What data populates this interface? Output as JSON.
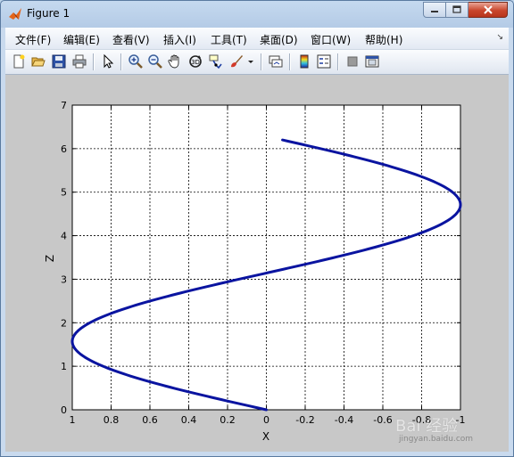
{
  "window": {
    "title": "Figure 1"
  },
  "menu": [
    {
      "label": "文件(F)",
      "name": "menu-file"
    },
    {
      "label": "编辑(E)",
      "name": "menu-edit"
    },
    {
      "label": "查看(V)",
      "name": "menu-view"
    },
    {
      "label": "插入(I)",
      "name": "menu-insert"
    },
    {
      "label": "工具(T)",
      "name": "menu-tools"
    },
    {
      "label": "桌面(D)",
      "name": "menu-desktop"
    },
    {
      "label": "窗口(W)",
      "name": "menu-window"
    },
    {
      "label": "帮助(H)",
      "name": "menu-help"
    }
  ],
  "toolbar": [
    "new-figure-icon",
    "open-file-icon",
    "save-icon",
    "print-icon",
    "edit-plot-pointer-icon",
    "zoom-in-icon",
    "zoom-out-icon",
    "pan-hand-icon",
    "rotate-3d-icon",
    "data-cursor-icon",
    "brush-icon",
    "link-plot-icon",
    "colorbar-icon",
    "legend-icon",
    "hide-plot-tools-icon",
    "show-plot-tools-icon"
  ],
  "colors": {
    "line": "#0a14a0",
    "figure_bg": "#c8c8c8",
    "axes_bg": "#ffffff"
  },
  "watermark": {
    "text": "Bai 经验",
    "url": "jingyan.baidu.com"
  },
  "chart_data": {
    "type": "line",
    "xlabel": "X",
    "ylabel": "Z",
    "xlim": [
      1,
      -1
    ],
    "ylim": [
      0,
      7
    ],
    "x_reversed": true,
    "grid": true,
    "grid_style": "dashed",
    "xticks": [
      1,
      0.8,
      0.6,
      0.4,
      0.2,
      0,
      -0.2,
      -0.4,
      -0.6,
      -0.8,
      -1
    ],
    "xtick_labels": [
      "1",
      "0.8",
      "0.6",
      "0.4",
      "0.2",
      "0",
      "-0.2",
      "-0.4",
      "-0.6",
      "-0.8",
      "-1"
    ],
    "yticks": [
      0,
      1,
      2,
      3,
      4,
      5,
      6,
      7
    ],
    "ytick_labels": [
      "0",
      "1",
      "2",
      "3",
      "4",
      "5",
      "6",
      "7"
    ],
    "series": [
      {
        "function": "x = sin(z)",
        "z_range": [
          0,
          6.2
        ],
        "x": [
          0.0,
          0.2,
          0.39,
          0.56,
          0.72,
          0.84,
          0.93,
          0.99,
          1.0,
          0.97,
          0.91,
          0.81,
          0.68,
          0.52,
          0.33,
          0.14,
          -0.06,
          -0.26,
          -0.44,
          -0.61,
          -0.76,
          -0.87,
          -0.95,
          -0.99,
          -1.0,
          -0.96,
          -0.89,
          -0.78,
          -0.64,
          -0.47,
          -0.28,
          -0.08
        ],
        "z": [
          0.0,
          0.2,
          0.4,
          0.6,
          0.8,
          1.0,
          1.2,
          1.4,
          1.6,
          1.8,
          2.0,
          2.2,
          2.4,
          2.6,
          2.8,
          3.0,
          3.2,
          3.4,
          3.6,
          3.8,
          4.0,
          4.2,
          4.4,
          4.6,
          4.8,
          5.0,
          5.2,
          5.4,
          5.6,
          5.8,
          6.0,
          6.2
        ]
      }
    ]
  }
}
